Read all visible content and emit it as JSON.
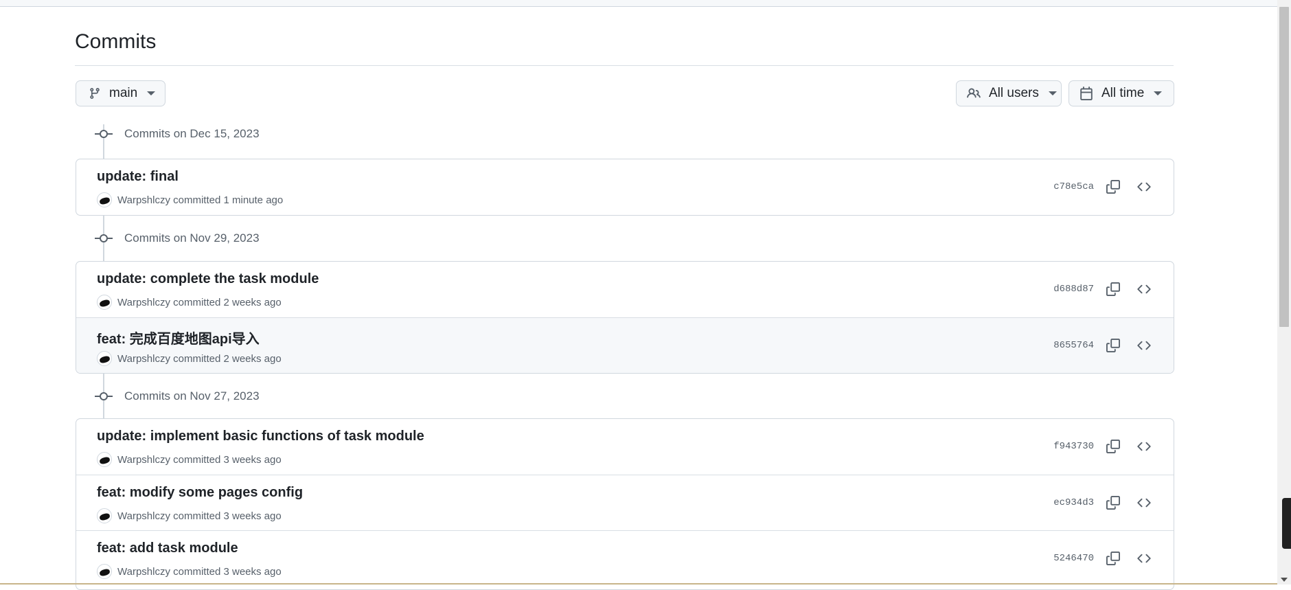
{
  "page": {
    "title": "Commits"
  },
  "toolbar": {
    "branch_label": "main",
    "users_label": "All users",
    "time_label": "All time"
  },
  "groups": [
    {
      "label": "Commits on Dec 15, 2023",
      "commits": [
        {
          "message": "update: final",
          "author": "Warpshlczy",
          "committed": "committed 1 minute ago",
          "sha": "c78e5ca"
        }
      ]
    },
    {
      "label": "Commits on Nov 29, 2023",
      "commits": [
        {
          "message": "update: complete the task module",
          "author": "Warpshlczy",
          "committed": "committed 2 weeks ago",
          "sha": "d688d87"
        },
        {
          "message": "feat: 完成百度地图api导入",
          "author": "Warpshlczy",
          "committed": "committed 2 weeks ago",
          "sha": "8655764"
        }
      ]
    },
    {
      "label": "Commits on Nov 27, 2023",
      "commits": [
        {
          "message": "update: implement basic functions of task module",
          "author": "Warpshlczy",
          "committed": "committed 3 weeks ago",
          "sha": "f943730"
        },
        {
          "message": "feat: modify some pages config",
          "author": "Warpshlczy",
          "committed": "committed 3 weeks ago",
          "sha": "ec934d3"
        },
        {
          "message": "feat: add task module",
          "author": "Warpshlczy",
          "committed": "committed 3 weeks ago",
          "sha": "5246470"
        }
      ]
    }
  ],
  "icons": {
    "branch": "git-branch-icon",
    "users": "people-icon",
    "time": "calendar-icon",
    "commit": "git-commit-icon",
    "copy": "copy-icon",
    "browse": "code-icon",
    "dropdown": "triangle-down-icon"
  },
  "colors": {
    "text": "#1f2328",
    "muted": "#57606a",
    "border": "#d0d7de",
    "button_bg": "#f6f8fa",
    "highlight_row": "#f6f8fa"
  }
}
